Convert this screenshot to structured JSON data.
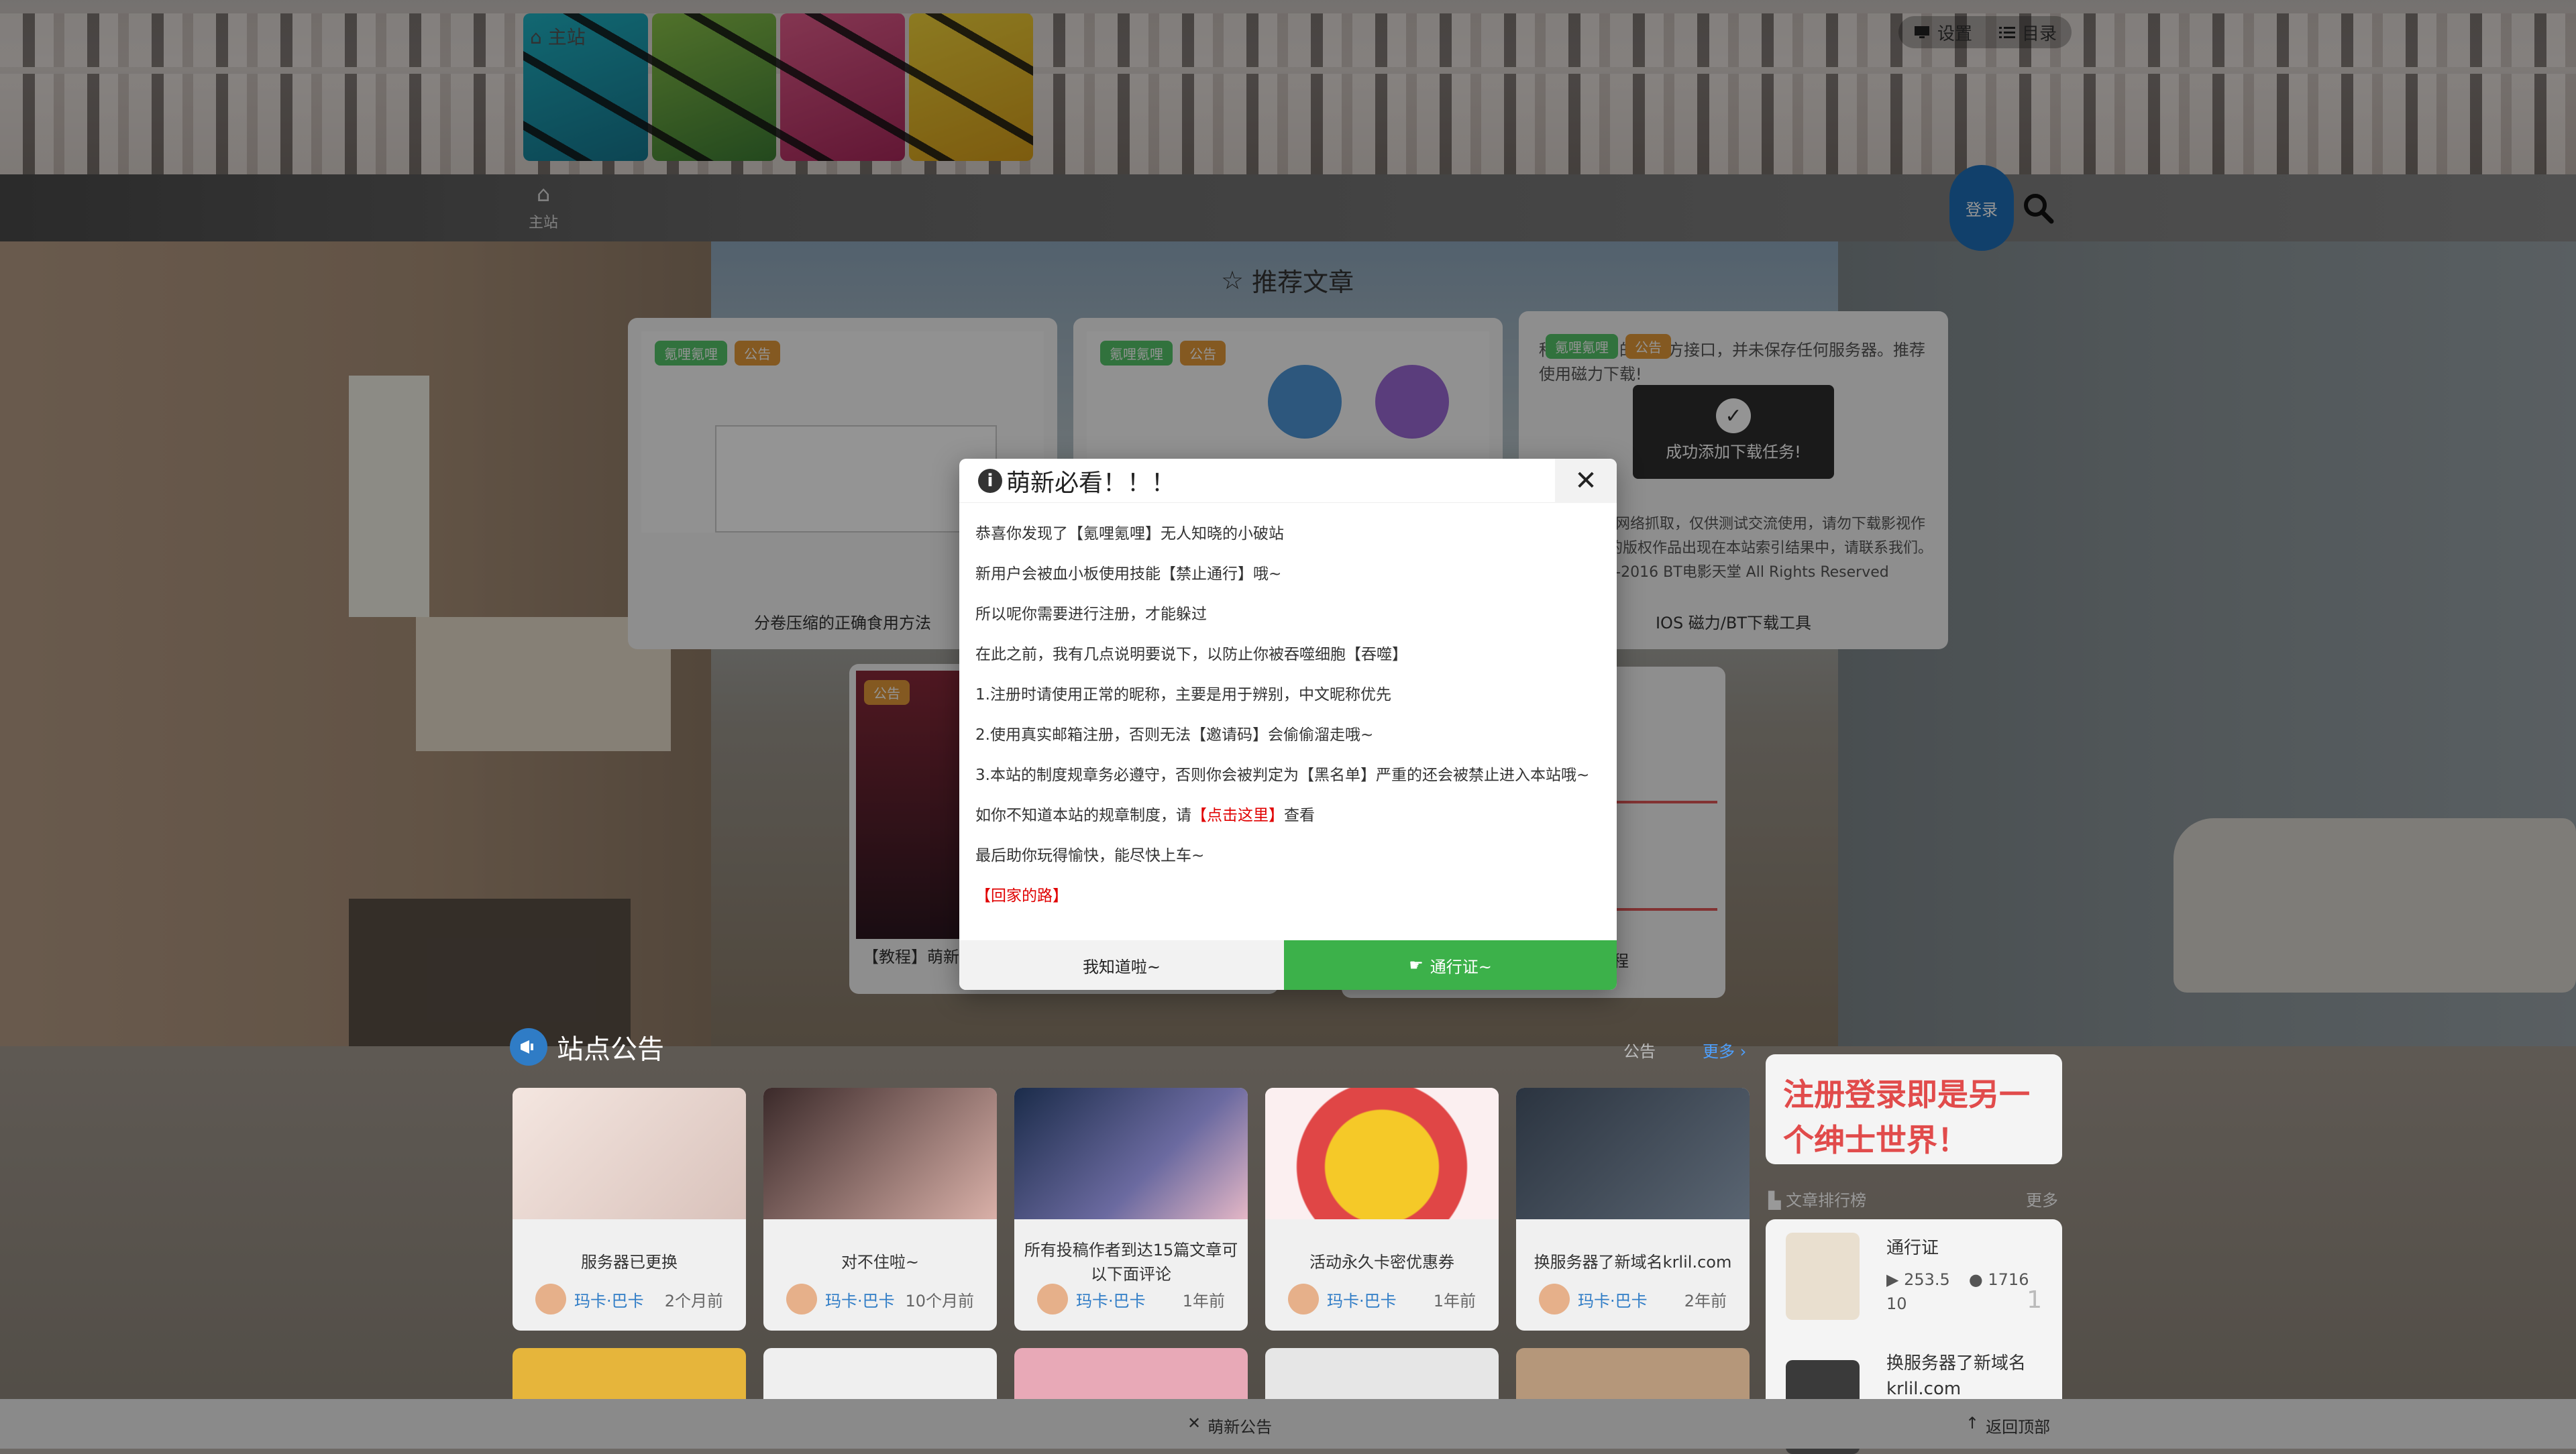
{
  "header": {
    "home_top": "主站",
    "top_links": [
      {
        "icon": "monitor-icon",
        "label": "设置"
      },
      {
        "icon": "list-icon",
        "label": "目录"
      }
    ]
  },
  "nav": {
    "home_label": "主站",
    "login_label": "登录",
    "search_icon": "search-icon"
  },
  "recommended": {
    "title": "推荐文章",
    "cards": [
      {
        "tags": [
          "氪哩氪哩",
          "公告"
        ],
        "caption": "分卷压缩的正确食用方法"
      },
      {
        "tags": [
          "氪哩氪哩",
          "公告"
        ],
        "caption": ""
      },
      {
        "tags": [
          "氪哩氪哩",
          "公告"
        ],
        "subtitle": "种子下载用的第三方接口，并未保存任何服务器。推荐使用磁力下载!",
        "toast": "成功添加下载任务!",
        "body": "数据均来自网络抓取，仅供测试交流使用，请勿下载影视作品。不愿您的版权作品出现在本站索引结果中，请联系我们。2015-2016 BT电影天堂 All Rights Reserved",
        "caption": "IOS 磁力/BT下载工具"
      }
    ],
    "row2": [
      {
        "tag": "公告",
        "caption": "【教程】萌新"
      },
      {
        "caption": "教程"
      }
    ]
  },
  "notices": {
    "title": "站点公告",
    "right_label": "公告",
    "more": "更多",
    "cards": [
      {
        "title": "服务器已更换",
        "author": "玛卡·巴卡",
        "time": "2个月前"
      },
      {
        "title": "对不住啦~",
        "author": "玛卡·巴卡",
        "time": "10个月前"
      },
      {
        "title": "所有投稿作者到达15篇文章可以下面评论",
        "author": "玛卡·巴卡",
        "time": "1年前"
      },
      {
        "title": "活动永久卡密优惠券",
        "author": "玛卡·巴卡",
        "time": "1年前"
      },
      {
        "title": "换服务器了新域名krlil.com",
        "author": "玛卡·巴卡",
        "time": "2年前"
      }
    ]
  },
  "sidebar": {
    "promo": "注册登录即是另一个绅士世界！",
    "rank_title": "文章排行榜",
    "rank_more": "更多",
    "rank_items": [
      {
        "title": "通行证",
        "views": "253.5",
        "comments": "1716",
        "extra": "10",
        "num": "1"
      },
      {
        "title": "换服务器了新域名krlil.com"
      }
    ]
  },
  "bottom": {
    "center": "萌新公告",
    "right": "返回顶部"
  },
  "modal": {
    "title": "萌新必看！！！",
    "lines": [
      "恭喜你发现了【氪哩氪哩】无人知晓的小破站",
      "新用户会被血小板使用技能【禁止通行】哦~",
      "所以呢你需要进行注册，才能躲过",
      "在此之前，我有几点说明要说下，以防止你被吞噬细胞【吞噬】",
      "1.注册时请使用正常的昵称，主要是用于辨别，中文昵称优先",
      "2.使用真实邮箱注册，否则无法【邀请码】会偷偷溜走哦~",
      "3.本站的制度规章务必遵守，否则你会被判定为【黑名单】严重的还会被禁止进入本站哦~"
    ],
    "rules_prefix": "如你不知道本站的规章制度，请",
    "rules_link": "【点击这里】",
    "rules_suffix": "查看",
    "closing": "最后助你玩得愉快，能尽快上车~",
    "home_link": "【回家的路】",
    "btn_ok": "我知道啦~",
    "btn_pass": "通行证~"
  }
}
